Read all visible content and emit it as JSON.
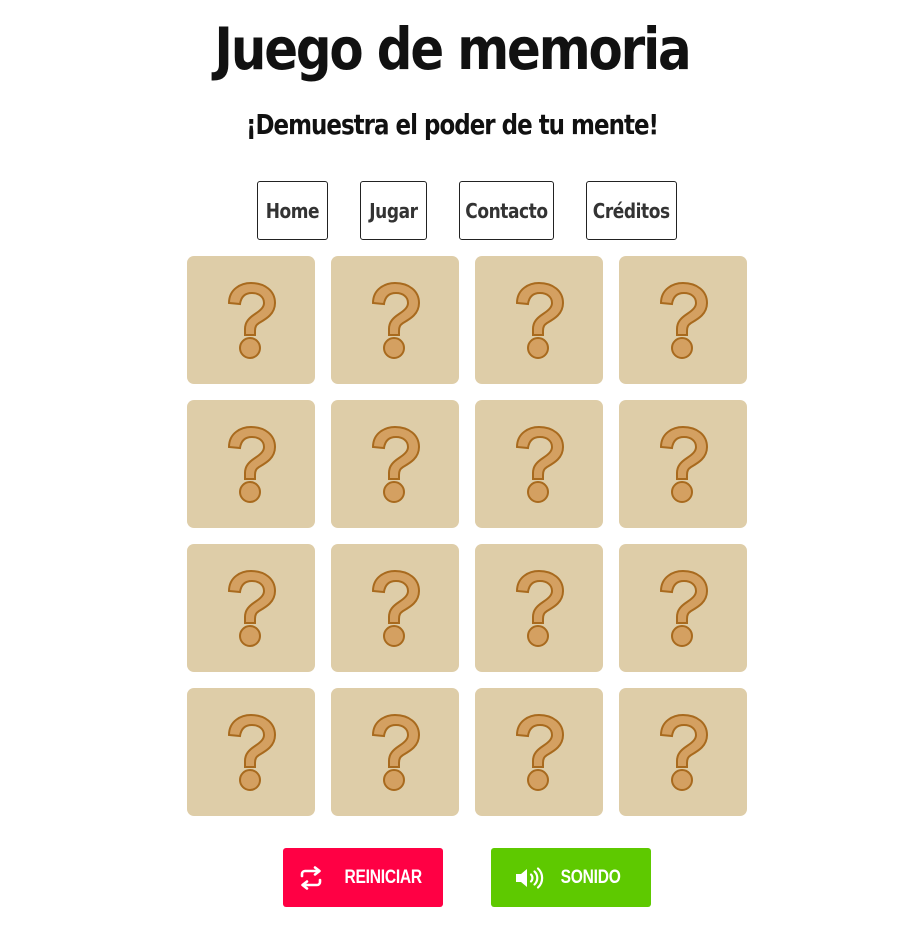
{
  "header": {
    "title": "Juego de memoria",
    "subtitle": "¡Demuestra el poder de tu mente!"
  },
  "nav": {
    "items": [
      {
        "label": "Home"
      },
      {
        "label": "Jugar"
      },
      {
        "label": "Contacto"
      },
      {
        "label": "Créditos"
      }
    ]
  },
  "board": {
    "rows": 4,
    "columns": 4,
    "card_face": "question-mark-icon",
    "card_color": "#decda8",
    "icon_fill": "#d4a061",
    "icon_stroke": "#a86a1e"
  },
  "controls": {
    "restart_label": "REINICIAR",
    "restart_icon": "repeat-icon",
    "restart_color": "#ff0044",
    "sound_label": "SONIDO",
    "sound_icon": "volume-icon",
    "sound_color": "#5ec900"
  }
}
